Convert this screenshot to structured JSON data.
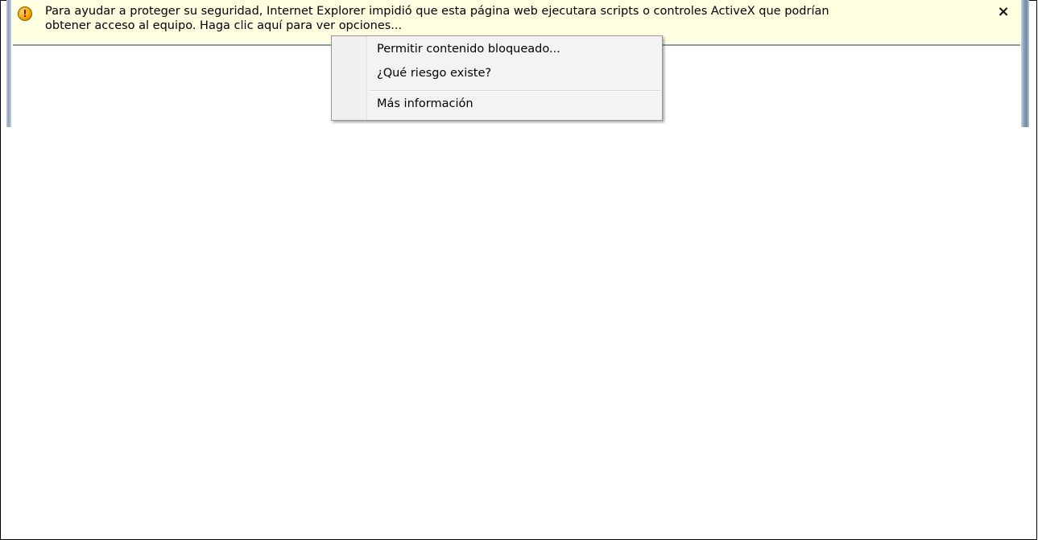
{
  "infobar": {
    "message_line1": "Para ayudar a proteger su seguridad, Internet Explorer impidió que esta página web ejecutara scripts o controles ActiveX que podrían",
    "message_line2": "obtener acceso al equipo. Haga clic aquí para ver opciones...",
    "warning_icon": "shield-warning-icon",
    "close_glyph": "×",
    "background_color": "#ffffe1"
  },
  "context_menu": {
    "items": [
      {
        "label": "Permitir contenido bloqueado..."
      },
      {
        "label": "¿Qué riesgo existe?"
      },
      {
        "label": "Más información"
      }
    ]
  }
}
